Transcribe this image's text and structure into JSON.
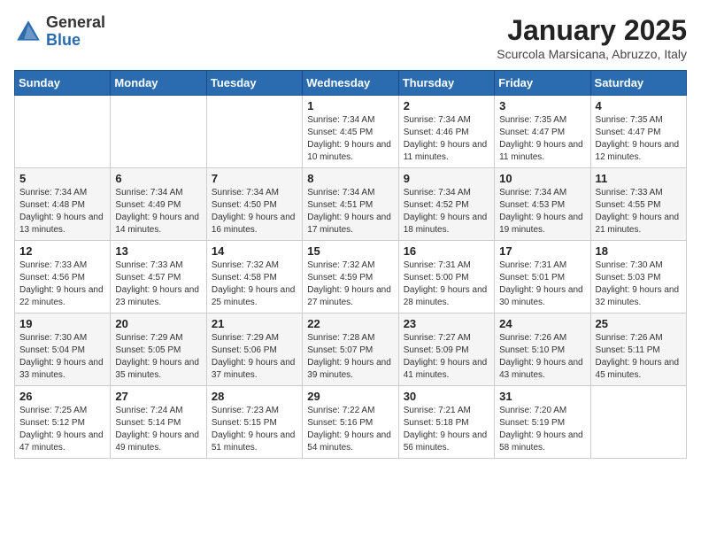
{
  "header": {
    "logo_general": "General",
    "logo_blue": "Blue",
    "month": "January 2025",
    "location": "Scurcola Marsicana, Abruzzo, Italy"
  },
  "weekdays": [
    "Sunday",
    "Monday",
    "Tuesday",
    "Wednesday",
    "Thursday",
    "Friday",
    "Saturday"
  ],
  "weeks": [
    [
      {
        "day": "",
        "text": ""
      },
      {
        "day": "",
        "text": ""
      },
      {
        "day": "",
        "text": ""
      },
      {
        "day": "1",
        "text": "Sunrise: 7:34 AM\nSunset: 4:45 PM\nDaylight: 9 hours and 10 minutes."
      },
      {
        "day": "2",
        "text": "Sunrise: 7:34 AM\nSunset: 4:46 PM\nDaylight: 9 hours and 11 minutes."
      },
      {
        "day": "3",
        "text": "Sunrise: 7:35 AM\nSunset: 4:47 PM\nDaylight: 9 hours and 11 minutes."
      },
      {
        "day": "4",
        "text": "Sunrise: 7:35 AM\nSunset: 4:47 PM\nDaylight: 9 hours and 12 minutes."
      }
    ],
    [
      {
        "day": "5",
        "text": "Sunrise: 7:34 AM\nSunset: 4:48 PM\nDaylight: 9 hours and 13 minutes."
      },
      {
        "day": "6",
        "text": "Sunrise: 7:34 AM\nSunset: 4:49 PM\nDaylight: 9 hours and 14 minutes."
      },
      {
        "day": "7",
        "text": "Sunrise: 7:34 AM\nSunset: 4:50 PM\nDaylight: 9 hours and 16 minutes."
      },
      {
        "day": "8",
        "text": "Sunrise: 7:34 AM\nSunset: 4:51 PM\nDaylight: 9 hours and 17 minutes."
      },
      {
        "day": "9",
        "text": "Sunrise: 7:34 AM\nSunset: 4:52 PM\nDaylight: 9 hours and 18 minutes."
      },
      {
        "day": "10",
        "text": "Sunrise: 7:34 AM\nSunset: 4:53 PM\nDaylight: 9 hours and 19 minutes."
      },
      {
        "day": "11",
        "text": "Sunrise: 7:33 AM\nSunset: 4:55 PM\nDaylight: 9 hours and 21 minutes."
      }
    ],
    [
      {
        "day": "12",
        "text": "Sunrise: 7:33 AM\nSunset: 4:56 PM\nDaylight: 9 hours and 22 minutes."
      },
      {
        "day": "13",
        "text": "Sunrise: 7:33 AM\nSunset: 4:57 PM\nDaylight: 9 hours and 23 minutes."
      },
      {
        "day": "14",
        "text": "Sunrise: 7:32 AM\nSunset: 4:58 PM\nDaylight: 9 hours and 25 minutes."
      },
      {
        "day": "15",
        "text": "Sunrise: 7:32 AM\nSunset: 4:59 PM\nDaylight: 9 hours and 27 minutes."
      },
      {
        "day": "16",
        "text": "Sunrise: 7:31 AM\nSunset: 5:00 PM\nDaylight: 9 hours and 28 minutes."
      },
      {
        "day": "17",
        "text": "Sunrise: 7:31 AM\nSunset: 5:01 PM\nDaylight: 9 hours and 30 minutes."
      },
      {
        "day": "18",
        "text": "Sunrise: 7:30 AM\nSunset: 5:03 PM\nDaylight: 9 hours and 32 minutes."
      }
    ],
    [
      {
        "day": "19",
        "text": "Sunrise: 7:30 AM\nSunset: 5:04 PM\nDaylight: 9 hours and 33 minutes."
      },
      {
        "day": "20",
        "text": "Sunrise: 7:29 AM\nSunset: 5:05 PM\nDaylight: 9 hours and 35 minutes."
      },
      {
        "day": "21",
        "text": "Sunrise: 7:29 AM\nSunset: 5:06 PM\nDaylight: 9 hours and 37 minutes."
      },
      {
        "day": "22",
        "text": "Sunrise: 7:28 AM\nSunset: 5:07 PM\nDaylight: 9 hours and 39 minutes."
      },
      {
        "day": "23",
        "text": "Sunrise: 7:27 AM\nSunset: 5:09 PM\nDaylight: 9 hours and 41 minutes."
      },
      {
        "day": "24",
        "text": "Sunrise: 7:26 AM\nSunset: 5:10 PM\nDaylight: 9 hours and 43 minutes."
      },
      {
        "day": "25",
        "text": "Sunrise: 7:26 AM\nSunset: 5:11 PM\nDaylight: 9 hours and 45 minutes."
      }
    ],
    [
      {
        "day": "26",
        "text": "Sunrise: 7:25 AM\nSunset: 5:12 PM\nDaylight: 9 hours and 47 minutes."
      },
      {
        "day": "27",
        "text": "Sunrise: 7:24 AM\nSunset: 5:14 PM\nDaylight: 9 hours and 49 minutes."
      },
      {
        "day": "28",
        "text": "Sunrise: 7:23 AM\nSunset: 5:15 PM\nDaylight: 9 hours and 51 minutes."
      },
      {
        "day": "29",
        "text": "Sunrise: 7:22 AM\nSunset: 5:16 PM\nDaylight: 9 hours and 54 minutes."
      },
      {
        "day": "30",
        "text": "Sunrise: 7:21 AM\nSunset: 5:18 PM\nDaylight: 9 hours and 56 minutes."
      },
      {
        "day": "31",
        "text": "Sunrise: 7:20 AM\nSunset: 5:19 PM\nDaylight: 9 hours and 58 minutes."
      },
      {
        "day": "",
        "text": ""
      }
    ]
  ]
}
